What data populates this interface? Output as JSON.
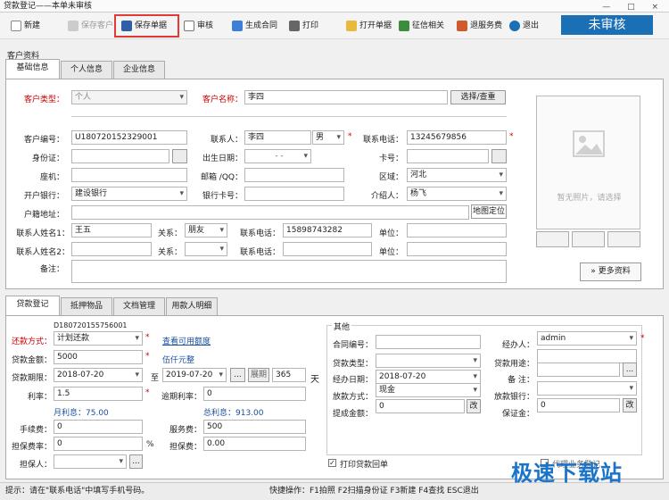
{
  "window": {
    "title": "贷款登记——本单未审核",
    "controls": "— □ ×"
  },
  "toolbar": {
    "new": "新建",
    "save_customer": "保存客户",
    "save_doc": "保存单据",
    "audit": "审核",
    "contract": "生成合同",
    "print": "打印",
    "open_doc": "打开单据",
    "credit": "征信相关",
    "refund": "退服务费",
    "exit": "退出",
    "status": "未审核"
  },
  "customer": {
    "section_title": "客户资料",
    "tabs": [
      "基础信息",
      "个人信息",
      "企业信息"
    ],
    "type_label": "客户类型：",
    "type_value": "个人",
    "name_label": "客户名称：",
    "name_value": "李四",
    "select_btn": "选择/查重",
    "code_label": "客户编号：",
    "code_value": "U180720152329001",
    "contact_label": "联系人：",
    "contact_value": "李四",
    "gender_value": "男",
    "phone_label": "联系电话：",
    "phone_value": "13245679856",
    "id_label": "身份证：",
    "birth_label": "出生日期：",
    "birth_value": "-   -",
    "card_label": "卡号：",
    "landline_label": "座机：",
    "email_label": "邮箱 /QQ：",
    "region_label": "区域：",
    "region_value": "河北",
    "bank_label": "开户银行：",
    "bank_value": "建设银行",
    "bank_card_label": "银行卡号：",
    "introducer_label": "介绍人：",
    "introducer_value": "杨飞",
    "address_label": "户籍地址：",
    "map_btn": "地图定位",
    "c1_name_label": "联系人姓名1：",
    "c1_name_value": "王五",
    "c1_rel_label": "关系：",
    "c1_rel_value": "朋友",
    "c1_phone_label": "联系电话：",
    "c1_phone_value": "15898743282",
    "c1_unit_label": "单位：",
    "c2_name_label": "联系人姓名2：",
    "c2_rel_label": "关系：",
    "c2_phone_label": "联系电话：",
    "c2_unit_label": "单位：",
    "remark_label": "备注：",
    "photo_text": "暂无照片，请选择",
    "more_btn": "更多资料"
  },
  "loan": {
    "tabs": [
      "贷款登记",
      "抵押物品",
      "文档管理",
      "用款人明细"
    ],
    "doc_no": "D180720155756001",
    "repay_label": "还款方式：",
    "repay_value": "计划还款",
    "quota_link": "查看可用额度",
    "amount_label": "贷款金额：",
    "amount_value": "5000",
    "amount_words": "伍仟元整",
    "period_label": "贷款期限：",
    "start_date": "2018-07-20",
    "to": "至",
    "end_date": "2019-07-20",
    "extend_btn": "展期",
    "days_value": "365",
    "days_unit": "天",
    "rate_label": "利率：",
    "rate_value": "1.5",
    "overdue_label": "逾期利率：",
    "overdue_value": "0",
    "month_interest": "月利息：75.00",
    "total_interest": "总利息：913.00",
    "handling_label": "手续费：",
    "handling_value": "0",
    "service_label": "服务费：",
    "service_value": "500",
    "guarantee_rate_label": "担保费率：",
    "guarantee_rate_value": "0",
    "percent": "%",
    "guarantee_fee_label": "担保费：",
    "guarantee_fee_value": "0.00",
    "guarantor_label": "担保人：",
    "ellipsis": "..."
  },
  "other": {
    "title": "其他",
    "contract_no_label": "合同编号：",
    "agent_label": "经办人：",
    "agent_value": "admin",
    "loan_type_label": "贷款类型：",
    "loan_use_label": "贷款用途：",
    "handle_date_label": "经办日期：",
    "handle_date_value": "2018-07-20",
    "note_label": "备  注：",
    "pay_method_label": "放款方式：",
    "pay_method_value": "现金",
    "pay_bank_label": "放款银行：",
    "deposit_label": "提成金额：",
    "deposit_value": "0",
    "change_btn": "改",
    "bond_label": "保证金：",
    "bond_value": "0",
    "print_receipt": "打印贷款回单",
    "agency_text": "代理业务登记"
  },
  "statusbar": {
    "hint": "提示：请在\"联系电话\"中填写手机号码。",
    "shortcuts": "快捷操作：F1拍照  F2扫描身份证  F3新建  F4查找  ESC退出"
  },
  "watermark": "极速下载站"
}
